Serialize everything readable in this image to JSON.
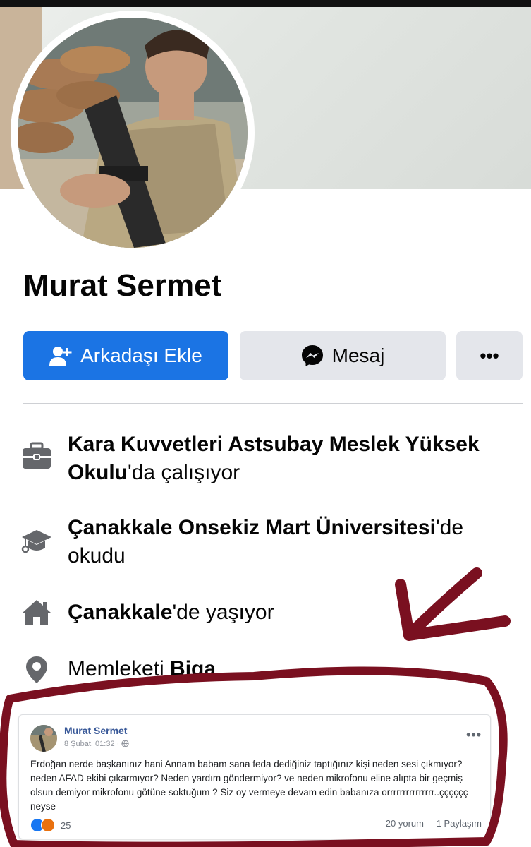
{
  "profile": {
    "name": "Murat Sermet",
    "buttons": {
      "add_friend": "Arkadaşı Ekle",
      "message": "Mesaj",
      "more": "•••"
    },
    "about": [
      {
        "icon": "briefcase-icon",
        "bold": "Kara Kuvvetleri Astsubay Meslek Yüksek Okulu",
        "suffix": "'da çalışıyor"
      },
      {
        "icon": "graduation-cap-icon",
        "bold": "Çanakkale Onsekiz Mart Üniversitesi",
        "suffix": "'de okudu"
      },
      {
        "icon": "home-icon",
        "bold": "Çanakkale",
        "suffix": "'de yaşıyor"
      },
      {
        "icon": "location-pin-icon",
        "prefix": "Memleketi ",
        "bold": "Biga"
      }
    ]
  },
  "post": {
    "author": "Murat Sermet",
    "date": "8 Şubat, 01:32 · ",
    "text": "Erdoğan nerde başkanınız hani Annam babam sana feda dediğiniz taptığınız kişi neden sesi çıkmıyor? neden AFAD ekibi çıkarmıyor? Neden yardım göndermiyor? ve neden mikrofonu eline alıpta bir geçmiş olsun demiyor mikrofonu götüne soktuğum ? Siz oy vermeye devam edin babanıza orrrrrrrrrrrrrrr..çççççç neyse",
    "reactions_count": "25",
    "comments": "20 yorum",
    "shares": "1 Paylaşım"
  },
  "colors": {
    "primary_button": "#1b74e4",
    "secondary_button": "#e4e6eb",
    "annotation": "#7a1020"
  }
}
